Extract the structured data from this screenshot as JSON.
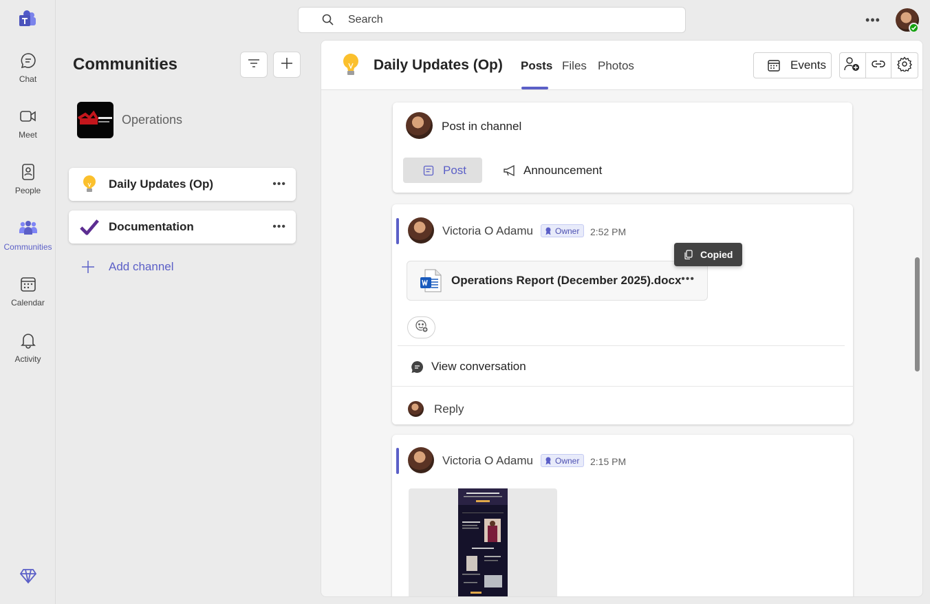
{
  "rail": {
    "items": [
      {
        "label": "Chat",
        "icon": "chat-icon"
      },
      {
        "label": "Meet",
        "icon": "video-camera-icon"
      },
      {
        "label": "People",
        "icon": "people-icon"
      },
      {
        "label": "Communities",
        "icon": "communities-icon",
        "active": true
      },
      {
        "label": "Calendar",
        "icon": "calendar-icon"
      },
      {
        "label": "Activity",
        "icon": "bell-icon"
      }
    ]
  },
  "search": {
    "placeholder": "Search"
  },
  "pane": {
    "title": "Communities",
    "community_name": "Operations",
    "channels": [
      {
        "name": "Daily Updates (Op)",
        "icon": "lightbulb-icon"
      },
      {
        "name": "Documentation",
        "icon": "checkmark-icon"
      }
    ],
    "add_channel_label": "Add channel"
  },
  "channel_header": {
    "title": "Daily Updates (Op)",
    "tabs": [
      "Posts",
      "Files",
      "Photos"
    ],
    "active_tab": "Posts",
    "events_label": "Events"
  },
  "composer": {
    "placeholder": "Post in channel",
    "post_label": "Post",
    "announcement_label": "Announcement"
  },
  "posts": [
    {
      "author": "Victoria O Adamu",
      "role": "Owner",
      "time": "2:52 PM",
      "file_name": "Operations Report (December 2025).docx",
      "view_conversation_label": "View conversation",
      "reply_label": "Reply"
    },
    {
      "author": "Victoria O Adamu",
      "role": "Owner",
      "time": "2:15 PM"
    }
  ],
  "tooltip": {
    "label": "Copied"
  },
  "colors": {
    "accent": "#5b5fc7",
    "presence": "#13a10e",
    "word_blue": "#185abd"
  }
}
